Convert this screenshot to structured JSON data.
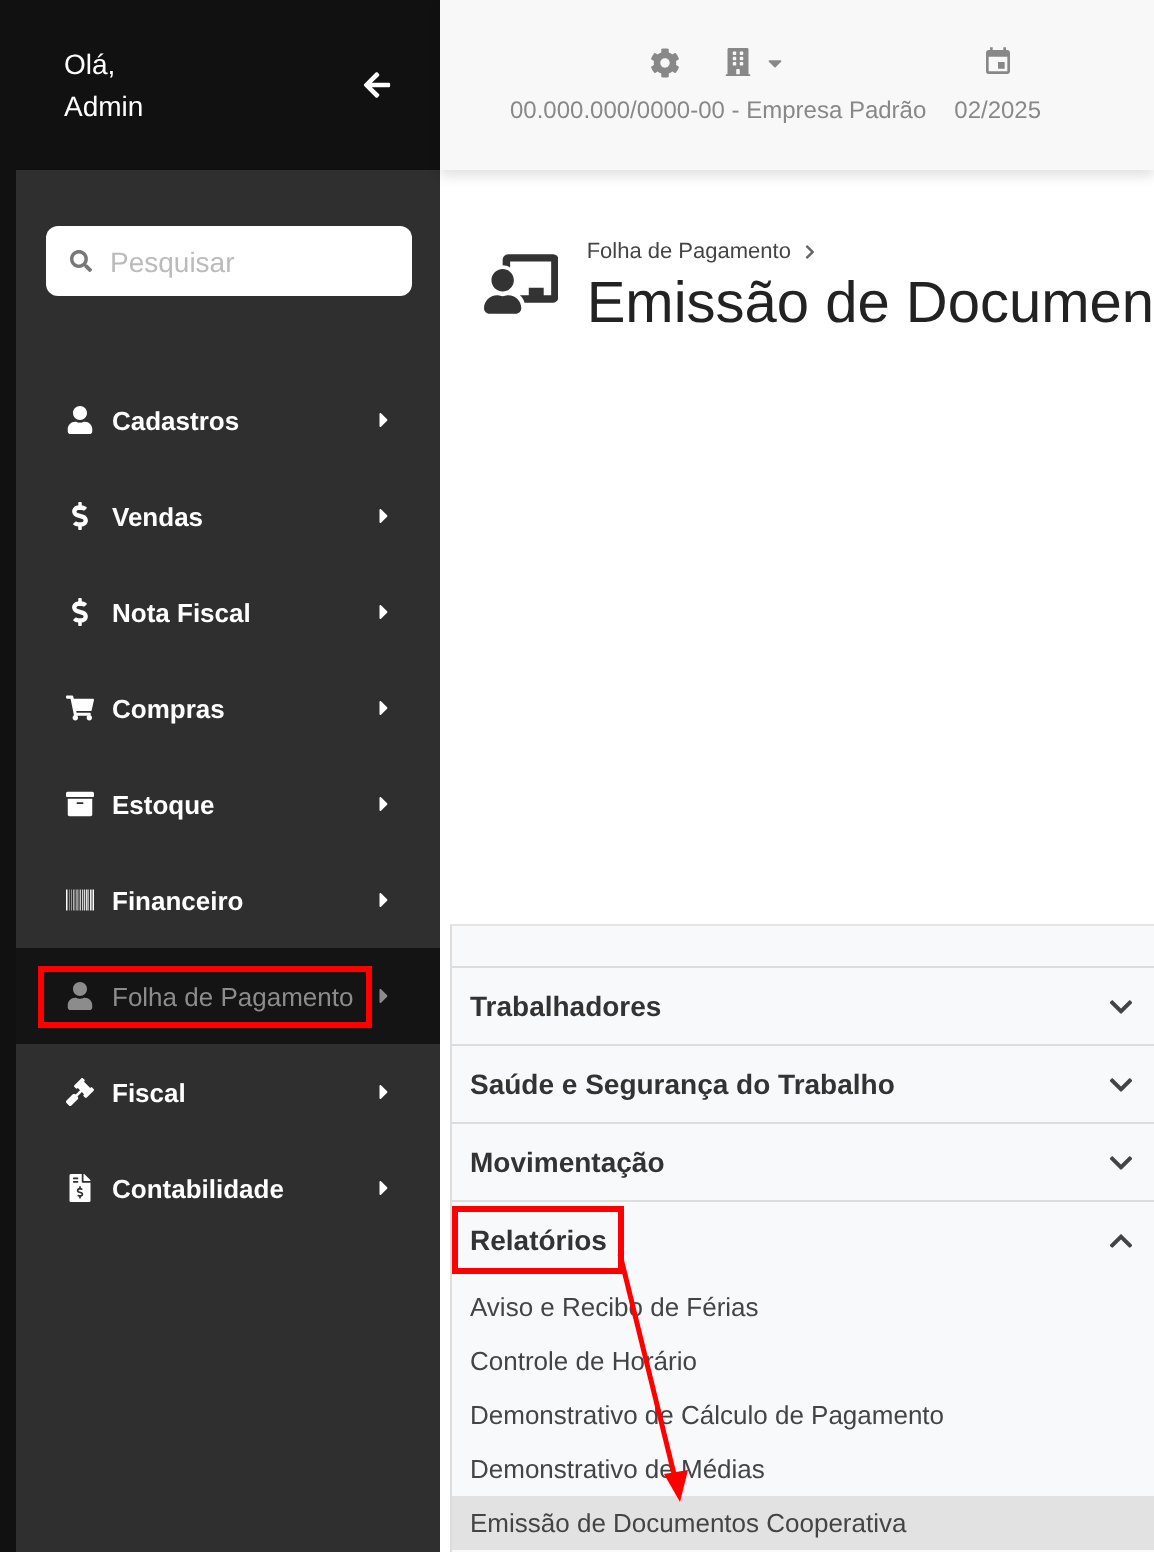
{
  "header": {
    "greeting": "Olá,",
    "user": "Admin"
  },
  "topbar": {
    "company": "00.000.000/0000-00 - Empresa Padrão",
    "period": "02/2025"
  },
  "search": {
    "placeholder": "Pesquisar"
  },
  "sidebar": {
    "items": [
      {
        "label": "Cadastros",
        "selected": false,
        "annotated": false
      },
      {
        "label": "Vendas",
        "selected": false,
        "annotated": false
      },
      {
        "label": "Nota Fiscal",
        "selected": false,
        "annotated": false
      },
      {
        "label": "Compras",
        "selected": false,
        "annotated": false
      },
      {
        "label": "Estoque",
        "selected": false,
        "annotated": false
      },
      {
        "label": "Financeiro",
        "selected": false,
        "annotated": false
      },
      {
        "label": "Folha de Pagamento",
        "selected": true,
        "annotated": true
      },
      {
        "label": "Fiscal",
        "selected": false,
        "annotated": false
      },
      {
        "label": "Contabilidade",
        "selected": false,
        "annotated": false
      }
    ]
  },
  "page": {
    "breadcrumb": "Folha de Pagamento",
    "title": "Emissão de Documen"
  },
  "submenu": {
    "sections": [
      {
        "title": "Trabalhadores",
        "expanded": false,
        "annotated": false
      },
      {
        "title": "Saúde e Segurança do Trabalho",
        "expanded": false,
        "annotated": false
      },
      {
        "title": "Movimentação",
        "expanded": false,
        "annotated": false
      },
      {
        "title": "Relatórios",
        "expanded": true,
        "annotated": true,
        "items": [
          {
            "label": "Aviso e Recibo de Férias",
            "selected": false
          },
          {
            "label": "Controle de Horário",
            "selected": false
          },
          {
            "label": "Demonstrativo de Cálculo de Pagamento",
            "selected": false
          },
          {
            "label": "Demonstrativo de Médias",
            "selected": false
          },
          {
            "label": "Emissão de Documentos Cooperativa",
            "selected": true
          }
        ]
      }
    ]
  }
}
